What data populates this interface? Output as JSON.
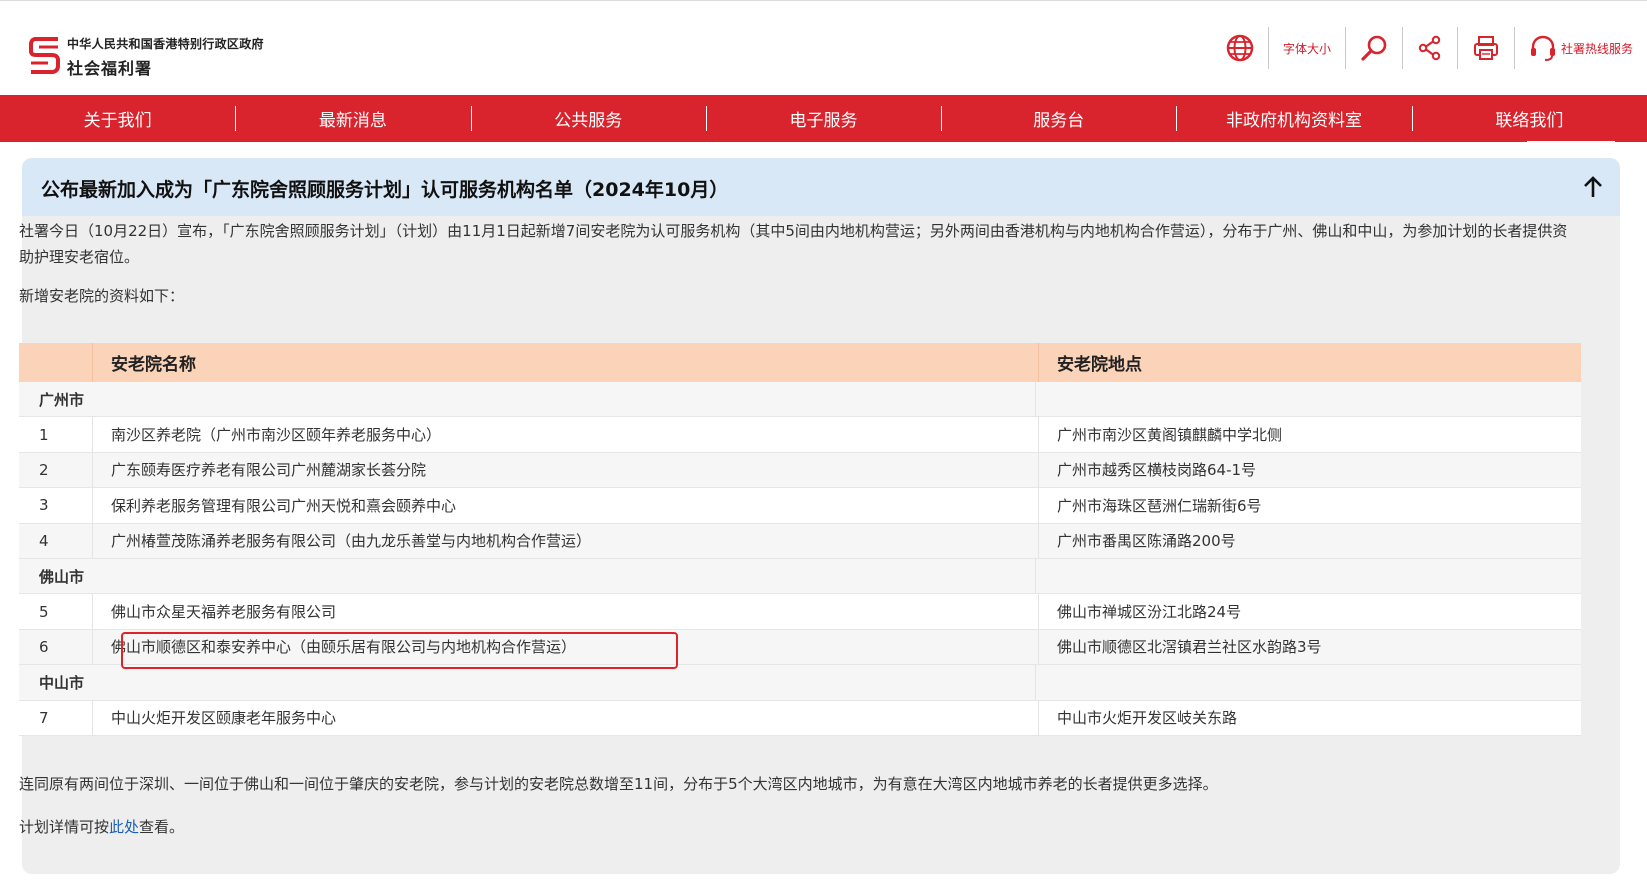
{
  "header": {
    "logo_line1": "中华人民共和国香港特别行政区政府",
    "logo_line2": "社会福利署",
    "tools": {
      "font_size_label": "字体大小",
      "hotline_label": "社署热线服务"
    },
    "icons": [
      "globe-icon",
      "search-icon",
      "share-icon",
      "print-icon",
      "headset-icon"
    ],
    "accent_color": "#d9232d"
  },
  "nav": {
    "items": [
      "关于我们",
      "最新消息",
      "公共服务",
      "电子服务",
      "服务台",
      "非政府机构资料室",
      "联络我们"
    ]
  },
  "article": {
    "title": "公布最新加入成为「广东院舍照顾服务计划」认可服务机构名单（2024年10月）",
    "intro": "社署今日（10月22日）宣布，「广东院舍照顾服务计划」（计划）由11月1日起新增7间安老院为认可服务机构（其中5间由内地机构营运；另外两间由香港机构与内地机构合作营运），分布于广州、佛山和中山，为参加计划的长者提供资助护理安老宿位。",
    "list_intro": "新增安老院的资料如下：",
    "table": {
      "headers": [
        "安老院名称",
        "安老院地点"
      ],
      "groups": [
        {
          "city": "广州市",
          "rows": [
            {
              "no": "1",
              "name": "南沙区养老院（广州市南沙区颐年养老服务中心）",
              "address": "广州市南沙区黄阁镇麒麟中学北侧"
            },
            {
              "no": "2",
              "name": "广东颐寿医疗养老有限公司广州麓湖家长荟分院",
              "address": "广州市越秀区横枝岗路64-1号"
            },
            {
              "no": "3",
              "name": "保利养老服务管理有限公司广州天悦和熹会颐养中心",
              "address": "广州市海珠区琶洲仁瑞新街6号"
            },
            {
              "no": "4",
              "name": "广州椿萱茂陈涌养老服务有限公司（由九龙乐善堂与内地机构合作营运）",
              "address": "广州市番禺区陈涌路200号"
            }
          ]
        },
        {
          "city": "佛山市",
          "rows": [
            {
              "no": "5",
              "name": "佛山市众星天福养老服务有限公司",
              "address": "佛山市禅城区汾江北路24号"
            },
            {
              "no": "6",
              "name": "佛山市顺德区和泰安养中心（由颐乐居有限公司与内地机构合作营运）",
              "address": "佛山市顺德区北滘镇君兰社区水韵路3号"
            }
          ]
        },
        {
          "city": "中山市",
          "rows": [
            {
              "no": "7",
              "name": "中山火炬开发区颐康老年服务中心",
              "address": "中山市火炬开发区岐关东路"
            }
          ]
        }
      ]
    },
    "outro": "连同原有两间位于深圳、一间位于佛山和一间位于肇庆的安老院，参与计划的安老院总数增至11间，分布于5个大湾区内地城市，为有意在大湾区内地城市养老的长者提供更多选择。",
    "detail_prefix": "计划详情可按",
    "detail_link": "此处",
    "detail_suffix": "查看。"
  }
}
